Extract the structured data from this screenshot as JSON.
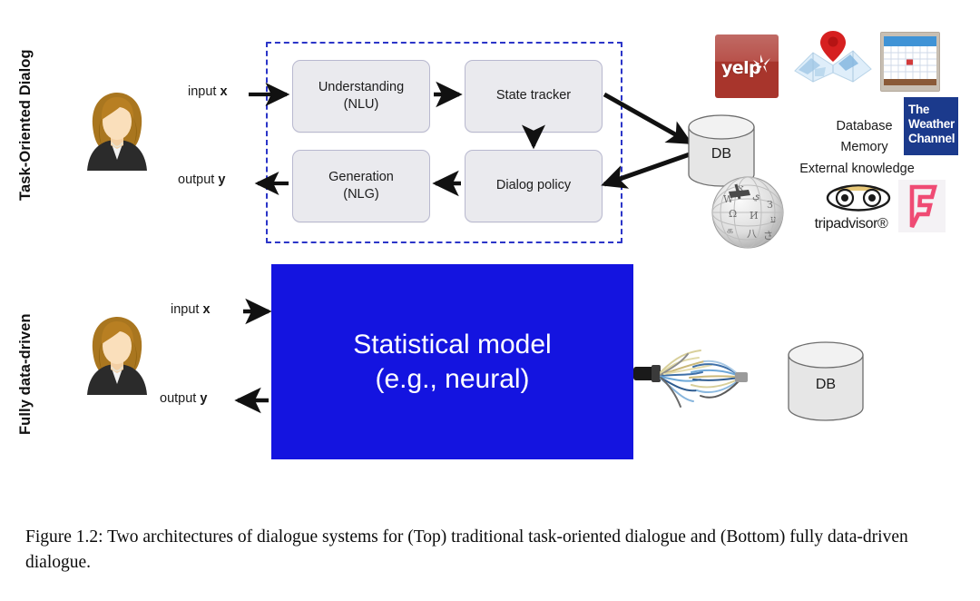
{
  "figure": {
    "caption": "Figure 1.2:  Two architectures of dialogue systems for (Top) traditional task-oriented dialogue and (Bottom) fully data-driven dialogue."
  },
  "rows": {
    "top": {
      "side_label": "Task-Oriented Dialog",
      "input_label_prefix": "input ",
      "input_label_var": "x",
      "output_label_prefix": "output ",
      "output_label_var": "y"
    },
    "bottom": {
      "side_label": "Fully data-driven",
      "input_label_prefix": "input ",
      "input_label_var": "x",
      "output_label_prefix": "output ",
      "output_label_var": "y"
    }
  },
  "pipeline": {
    "boxes": [
      {
        "id": "nlu",
        "line1": "Understanding",
        "line2": "(NLU)"
      },
      {
        "id": "state",
        "line1": "State tracker",
        "line2": ""
      },
      {
        "id": "nlg",
        "line1": "Generation",
        "line2": "(NLG)"
      },
      {
        "id": "policy",
        "line1": "Dialog policy",
        "line2": ""
      }
    ],
    "dashed_border_color": "#2b35c8",
    "box_fill": "#eaeaee"
  },
  "statistical_model": {
    "line1": "Statistical model",
    "line2": "(e.g., neural)",
    "fill_color": "#1414e0",
    "text_color": "#ffffff"
  },
  "databases": {
    "top_db_label": "DB",
    "bottom_db_label": "DB"
  },
  "knowledge_sources": {
    "lines": [
      "Database",
      "Memory",
      "External knowledge"
    ],
    "logos": [
      {
        "name": "yelp",
        "text": "yelp",
        "color": "#a8352c"
      },
      {
        "name": "map",
        "text": "",
        "color": "#cf2222"
      },
      {
        "name": "calendar",
        "text": "",
        "color": "#3f93d6"
      },
      {
        "name": "weather",
        "text": "The Weather Channel",
        "color": "#1b3a8c"
      },
      {
        "name": "wikipedia",
        "text": "",
        "color": "#9a9a9a"
      },
      {
        "name": "tripadvisor",
        "text": "tripadvisor",
        "color": "#1a1a1a"
      },
      {
        "name": "foursquare",
        "text": "",
        "color": "#ef4b74"
      }
    ],
    "weather_lines": [
      "The",
      "Weather",
      "Channel"
    ],
    "tripadvisor_word": "tripadvisor®"
  }
}
